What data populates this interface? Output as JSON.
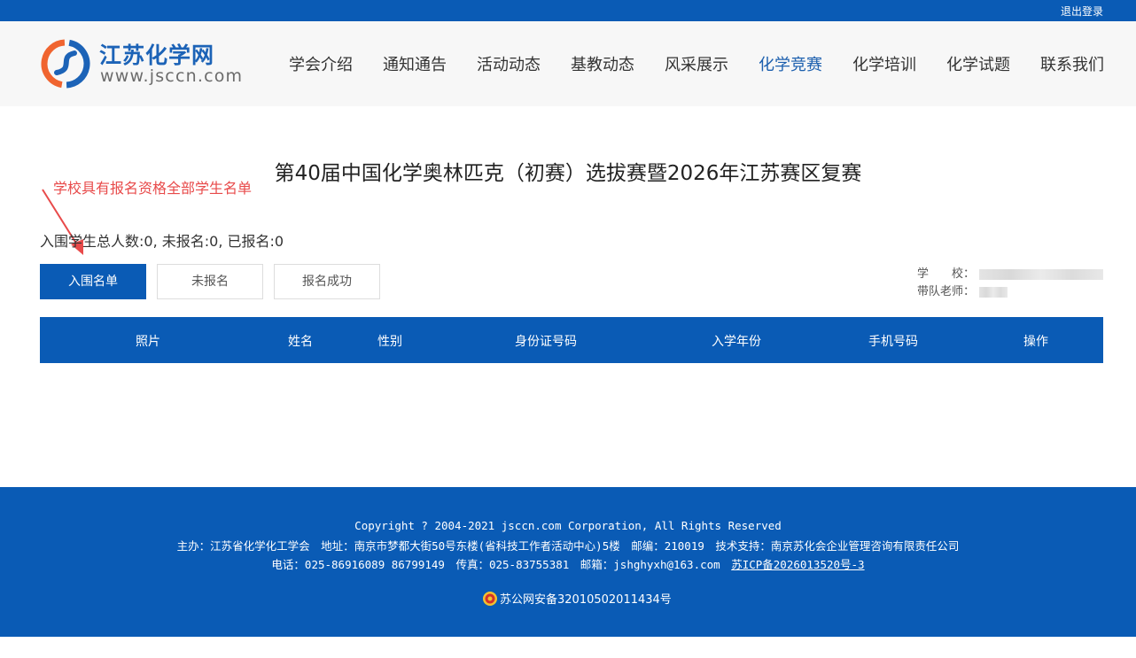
{
  "topbar": {
    "logout_label": "退出登录"
  },
  "logo": {
    "title": "江苏化学网",
    "url": "www.jsccn.com"
  },
  "nav": {
    "items": [
      "学会介绍",
      "通知通告",
      "活动动态",
      "基教动态",
      "风采展示",
      "化学竞赛",
      "化学培训",
      "化学试题",
      "联系我们"
    ],
    "active_index": 5
  },
  "page": {
    "title": "第40届中国化学奥林匹克（初赛）选拔赛暨2026年江苏赛区复赛",
    "annotation": "学校具有报名资格全部学生名单",
    "stats": "入围学生总人数:0, 未报名:0, 已报名:0"
  },
  "tabs": [
    {
      "label": "入围名单",
      "active": true
    },
    {
      "label": "未报名",
      "active": false
    },
    {
      "label": "报名成功",
      "active": false
    }
  ],
  "school_info": {
    "school_label": "学　　校：",
    "teacher_label": "带队老师："
  },
  "table": {
    "columns": [
      "照片",
      "姓名",
      "性别",
      "身份证号码",
      "入学年份",
      "手机号码",
      "操作"
    ],
    "rows": []
  },
  "footer": {
    "copyright": "Copyright ? 2004-2021 jsccn.com Corporation, All Rights Reserved",
    "organizer": "主办：江苏省化学化工学会　地址：南京市梦都大街50号东楼(省科技工作者活动中心)5楼　邮编：210019　技术支持：南京苏化会企业管理咨询有限责任公司",
    "contact": "电话：025-86916089 86799149　传真：025-83755381　邮箱：jshghyxh@163.com　",
    "icp": "苏ICP备2026013520号-3",
    "police": "苏公网安备32010502011434号"
  },
  "colors": {
    "primary": "#0a5bb5",
    "annotation": "#e84a4a",
    "logo_blue": "#1c63b7",
    "logo_orange": "#f0642f"
  }
}
